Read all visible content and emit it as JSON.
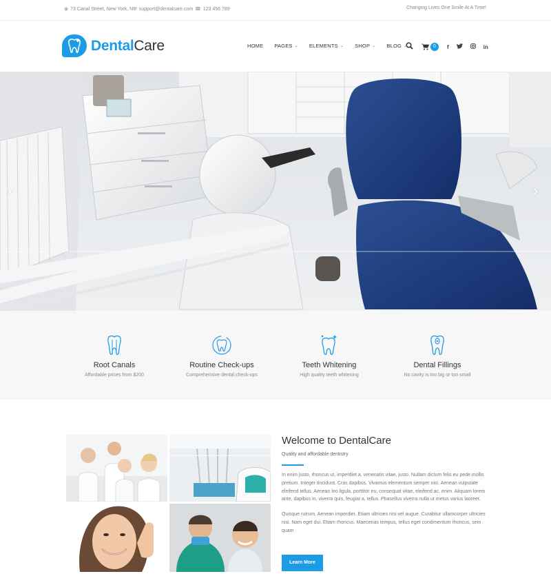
{
  "topbar": {
    "address": "73 Canal Street, New York, NY",
    "email": "support@dentalcare.com",
    "phone": "123 456 789",
    "tagline": "Changing Lives One Smile At A Time!"
  },
  "brand": {
    "name_part1": "Dental",
    "name_part2": "Care",
    "accent": "#1c9be6"
  },
  "nav": {
    "items": [
      {
        "label": "HOME",
        "dropdown": false
      },
      {
        "label": "PAGES",
        "dropdown": true
      },
      {
        "label": "ELEMENTS",
        "dropdown": true
      },
      {
        "label": "SHOP",
        "dropdown": true
      },
      {
        "label": "BLOG",
        "dropdown": true
      }
    ],
    "cart_count": "0",
    "icons": [
      "search-icon",
      "cart-icon",
      "facebook-icon",
      "twitter-icon",
      "instagram-icon",
      "linkedin-icon"
    ]
  },
  "hero": {
    "prev_arrow": "‹",
    "next_arrow": "›"
  },
  "features": [
    {
      "title": "Root Canals",
      "desc": "Affordable prices from $200",
      "icon": "tooth-icon"
    },
    {
      "title": "Routine Check-ups",
      "desc": "Comprehensive dental check-ups",
      "icon": "tooth-refresh-icon"
    },
    {
      "title": "Teeth Whitening",
      "desc": "High quality teeth whitening",
      "icon": "tooth-sparkle-icon"
    },
    {
      "title": "Dental Fillings",
      "desc": "No cavity is too big or too small",
      "icon": "tooth-filling-icon"
    }
  ],
  "about": {
    "title": "Welcome to DentalCare",
    "subtitle": "Quality and affordable dentistry",
    "para1": "In enim justo, rhoncus ut, imperdiet a, venenatis vitae, justo. Nullam dictum felis eu pede mollis pretium. Integer tincidunt. Cras dapibus. Vivamus elementum semper nisi. Aenean vulputate eleifend tellus. Aenean leo ligula, porttitor eu, consequat vitae, eleifend ac, enim. Aliquam lorem ante, dapibus in, viverra quis, feugiat a, tellus. Phasellus viverra nulla ut metus varius laoreet.",
    "para2": "Quisque rutrum. Aenean imperdiet. Etiam ultricies nisi vel augue. Curabitur ullamcorper ultricies nisi. Nam eget dui. Etiam rhoncus. Maecenas tempus, tellus eget condimentum rhoncus, sem quam",
    "button": "Learn More"
  }
}
